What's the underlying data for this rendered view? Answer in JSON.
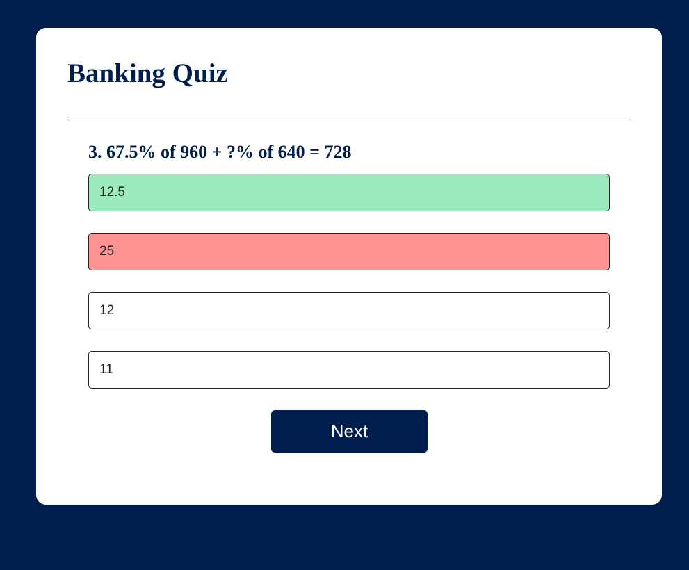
{
  "quiz": {
    "title": "Banking Quiz",
    "question": "3. 67.5% of 960 + ?% of 640 = 728",
    "answers": [
      {
        "label": "12.5",
        "state": "correct"
      },
      {
        "label": "25",
        "state": "incorrect"
      },
      {
        "label": "12",
        "state": "neutral"
      },
      {
        "label": "11",
        "state": "neutral"
      }
    ],
    "next_label": "Next"
  },
  "colors": {
    "background": "#001e4d",
    "card": "#ffffff",
    "correct": "#9aeabc",
    "incorrect": "#ff9393",
    "neutral": "#ffffff",
    "button": "#001e4d"
  }
}
